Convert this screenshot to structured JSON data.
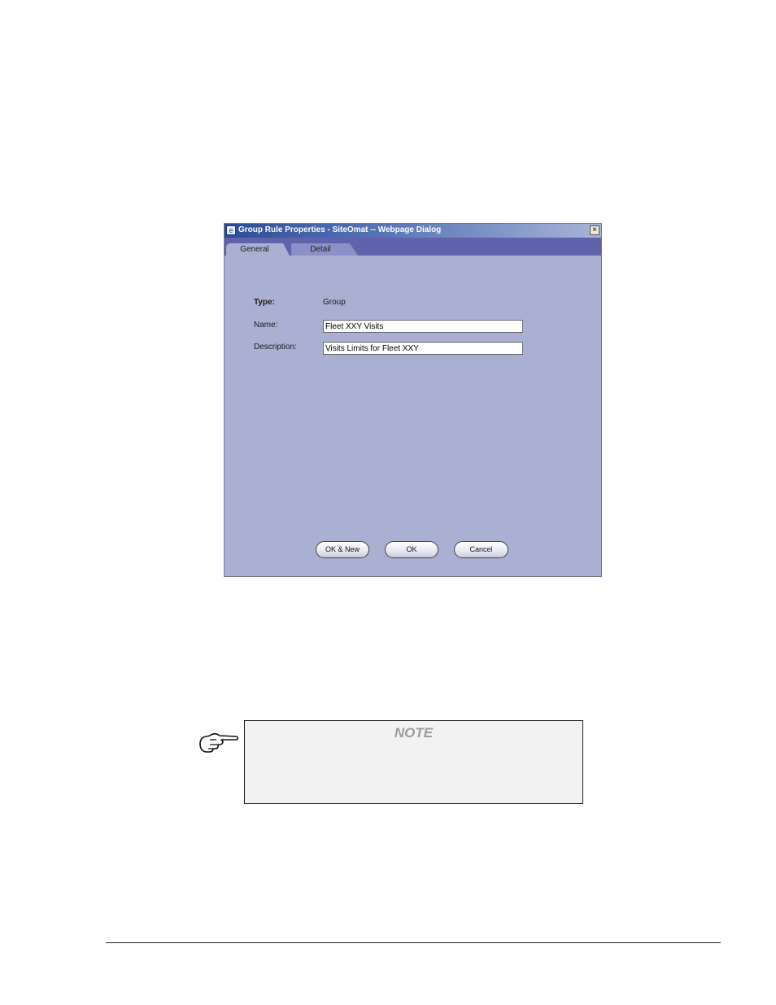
{
  "dialog": {
    "title": "Group Rule Properties - SiteOmat -- Webpage Dialog",
    "tabs": [
      {
        "label": "General",
        "active": true
      },
      {
        "label": "Detail",
        "active": false
      }
    ],
    "form": {
      "type_label": "Type:",
      "type_value": "Group",
      "name_label": "Name:",
      "name_value": "Fleet XXY Visits",
      "description_label": "Description:",
      "description_value": "Visits Limits for Fleet XXY"
    },
    "buttons": {
      "ok_new": "OK & New",
      "ok": "OK",
      "cancel": "Cancel"
    }
  },
  "note": {
    "title": "NOTE"
  },
  "colors": {
    "dialog_bg": "#a9b0d2",
    "tabbar_bg": "#6062ac",
    "title_gradient_start": "#2b4c9a"
  }
}
